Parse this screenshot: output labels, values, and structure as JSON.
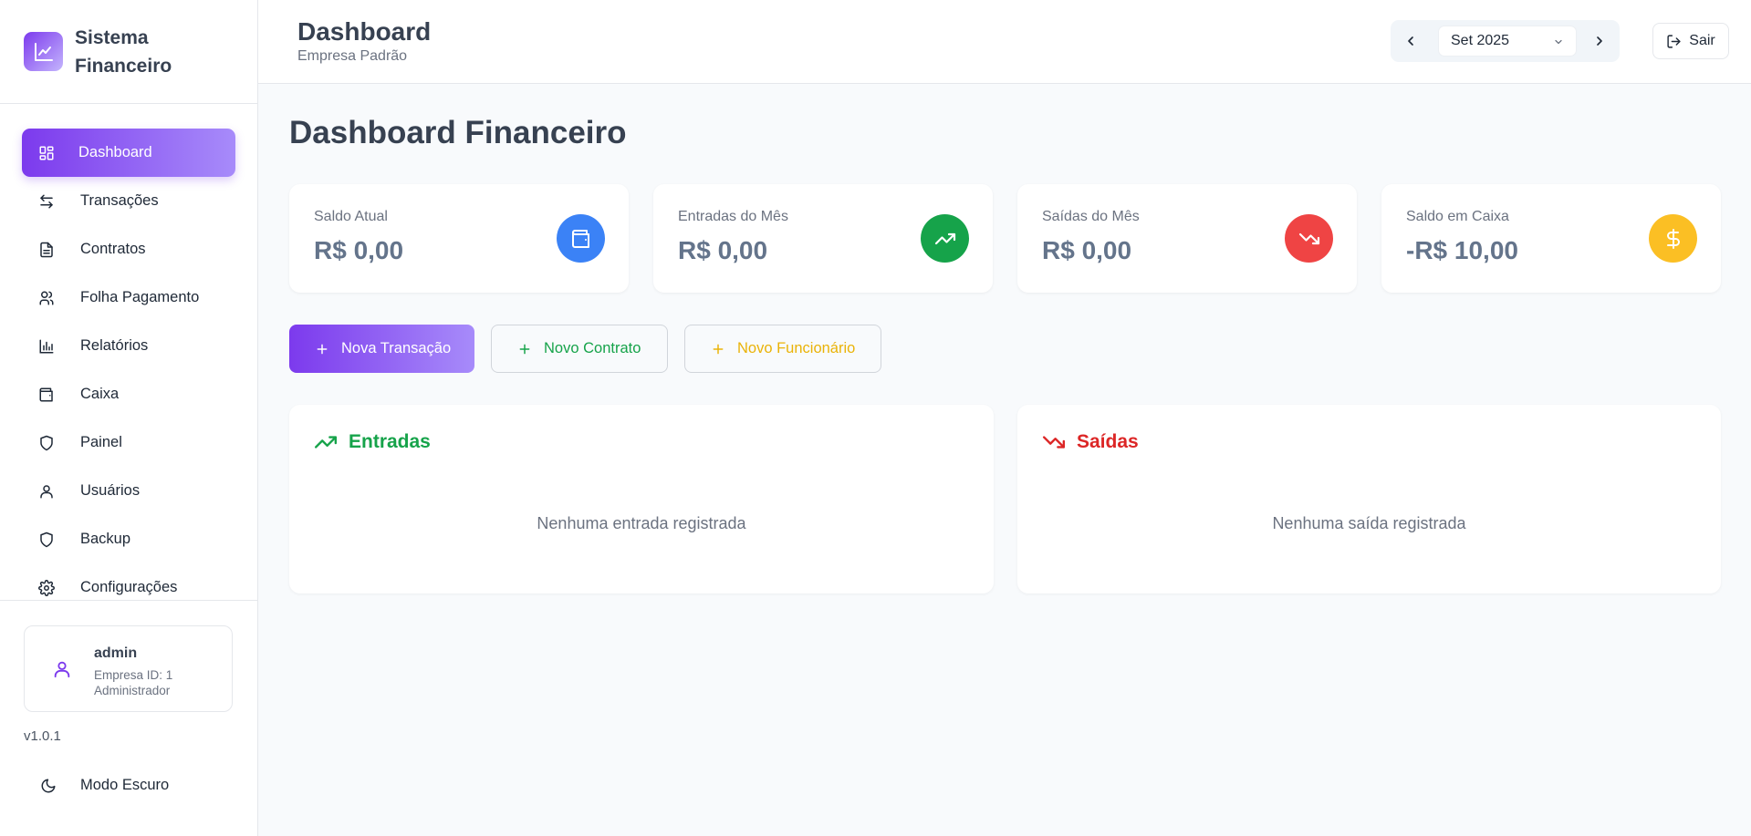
{
  "brand": {
    "name": "Sistema Financeiro",
    "logo_icon": "chart-line-icon"
  },
  "sidebar": {
    "items": [
      {
        "label": "Dashboard",
        "icon": "grid-icon",
        "active": true
      },
      {
        "label": "Transações",
        "icon": "arrows-swap-icon"
      },
      {
        "label": "Contratos",
        "icon": "document-icon"
      },
      {
        "label": "Folha Pagamento",
        "icon": "users-icon"
      },
      {
        "label": "Relatórios",
        "icon": "bar-chart-icon"
      },
      {
        "label": "Caixa",
        "icon": "wallet-icon"
      },
      {
        "label": "Painel",
        "icon": "shield-icon"
      },
      {
        "label": "Usuários",
        "icon": "user-icon"
      },
      {
        "label": "Backup",
        "icon": "shield-icon"
      },
      {
        "label": "Configurações",
        "icon": "gear-icon"
      }
    ]
  },
  "user": {
    "name": "admin",
    "company": "Empresa ID: 1",
    "role": "Administrador"
  },
  "version": "v1.0.1",
  "dark_mode_label": "Modo Escuro",
  "header": {
    "title": "Dashboard",
    "subtitle": "Empresa Padrão",
    "month": "Set 2025",
    "logout_label": "Sair"
  },
  "main": {
    "title": "Dashboard Financeiro",
    "stats": [
      {
        "label": "Saldo Atual",
        "value": "R$ 0,00",
        "icon": "wallet-icon",
        "color": "#3b82f6"
      },
      {
        "label": "Entradas do Mês",
        "value": "R$ 0,00",
        "icon": "trending-up-icon",
        "color": "#16a34a"
      },
      {
        "label": "Saídas do Mês",
        "value": "R$ 0,00",
        "icon": "trending-down-icon",
        "color": "#ef4444"
      },
      {
        "label": "Saldo em Caixa",
        "value": "-R$ 10,00",
        "icon": "dollar-icon",
        "color": "#fbbf24"
      }
    ],
    "actions": {
      "new_transaction": "Nova Transação",
      "new_contract": "Novo Contrato",
      "new_employee": "Novo Funcionário"
    },
    "panels": {
      "income": {
        "title": "Entradas",
        "empty": "Nenhuma entrada registrada",
        "color": "#16a34a"
      },
      "expenses": {
        "title": "Saídas",
        "empty": "Nenhuma saída registrada",
        "color": "#dc2626"
      }
    }
  },
  "colors": {
    "accent": "#7c3aed",
    "accent_light": "#a78bfa"
  }
}
